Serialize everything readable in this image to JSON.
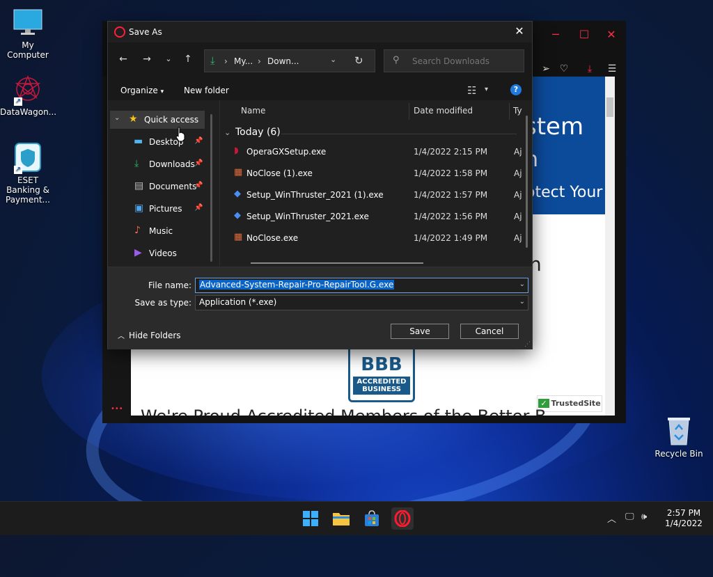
{
  "desktop": {
    "icons": [
      {
        "label": "My Computer",
        "icon": "monitor-icon"
      },
      {
        "label": "DataWagon...",
        "icon": "datawagon-logo-icon"
      },
      {
        "label": "ESET Banking & Payment...",
        "icon": "eset-shield-icon"
      }
    ],
    "recycle_bin": {
      "label": "Recycle Bin",
      "icon": "recycle-bin-icon"
    }
  },
  "browser": {
    "hero_line1": "stem",
    "hero_line2": "n",
    "hero_line3": "otect Your",
    "body_fragment": "n",
    "bbb": {
      "big": "BBB",
      "line1": "ACCREDITED",
      "line2": "BUSINESS"
    },
    "trusted_site": "TrustedSite",
    "trusted_check": "✓",
    "bottom_text": "We're Proud Accredited Members of the Better B",
    "sidebar_dots": "•••"
  },
  "dialog": {
    "title": "Save As",
    "address": {
      "crumb1": "My...",
      "sep": "›",
      "crumb2": "Down..."
    },
    "search_placeholder": "Search Downloads",
    "organize": "Organize",
    "new_folder": "New folder",
    "help": "?",
    "nav": [
      {
        "label": "Quick access",
        "icon": "star-icon",
        "pinned": false
      },
      {
        "label": "Desktop",
        "icon": "desktop-folder-icon",
        "pinned": true
      },
      {
        "label": "Downloads",
        "icon": "download-icon",
        "pinned": true
      },
      {
        "label": "Documents",
        "icon": "documents-icon",
        "pinned": true
      },
      {
        "label": "Pictures",
        "icon": "pictures-icon",
        "pinned": true
      },
      {
        "label": "Music",
        "icon": "music-icon",
        "pinned": false
      },
      {
        "label": "Videos",
        "icon": "videos-icon",
        "pinned": false
      }
    ],
    "columns": {
      "name": "Name",
      "date": "Date modified",
      "type": "Ty"
    },
    "group": "Today (6)",
    "files": [
      {
        "name": "OperaGXSetup.exe",
        "date": "1/4/2022 2:15 PM",
        "type": "Aj"
      },
      {
        "name": "NoClose (1).exe",
        "date": "1/4/2022 1:58 PM",
        "type": "Aj"
      },
      {
        "name": "Setup_WinThruster_2021 (1).exe",
        "date": "1/4/2022 1:57 PM",
        "type": "Aj"
      },
      {
        "name": "Setup_WinThruster_2021.exe",
        "date": "1/4/2022 1:56 PM",
        "type": "Aj"
      },
      {
        "name": "NoClose.exe",
        "date": "1/4/2022 1:49 PM",
        "type": "Aj"
      }
    ],
    "file_name_label": "File name:",
    "file_name_value": "Advanced-System-Repair-Pro-RepairTool.G.exe",
    "save_type_label": "Save as type:",
    "save_type_value": "Application (*.exe)",
    "hide_folders": "Hide Folders",
    "save": "Save",
    "cancel": "Cancel"
  },
  "taskbar": {
    "clock_time": "2:57 PM",
    "clock_date": "1/4/2022"
  },
  "colors": {
    "opera_red": "#ff1b2d",
    "accent_blue": "#0a64c8",
    "dialog_bg": "#202020"
  }
}
